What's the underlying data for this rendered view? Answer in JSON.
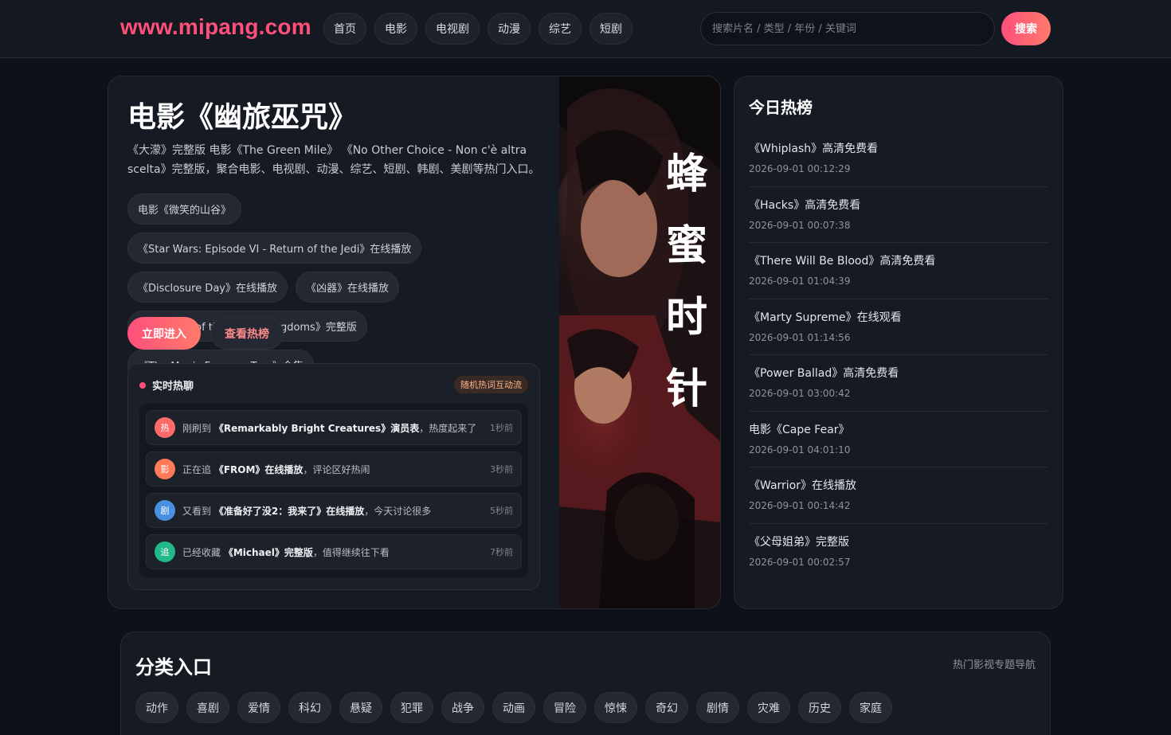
{
  "site": {
    "logo": "www.mipang.com"
  },
  "nav": [
    "首页",
    "电影",
    "电视剧",
    "动漫",
    "综艺",
    "短剧"
  ],
  "search": {
    "placeholder": "搜索片名 / 类型 / 年份 / 关键词",
    "button": "搜索"
  },
  "hero": {
    "title": "电影《幽旅巫咒》",
    "description": "《大濛》完整版 电影《The Green Mile》 《No Other Choice - Non c'è altra scelta》完整版，聚合电影、电视剧、动漫、综艺、短剧、韩剧、美剧等热门入口。",
    "chips": [
      "电影《微笑的山谷》",
      "《Star Wars: Episode VI - Return of the Jedi》在线播放",
      "《Disclosure Day》在线播放",
      "《凶器》在线播放",
      "《A Knight of the Seven Kingdoms》完整版",
      "《The Magic Faraway Tree》全集"
    ],
    "primary_button": "立即进入",
    "secondary_button": "查看热榜"
  },
  "live": {
    "title": "实时热聊",
    "badge": "随机热词互动流",
    "rows": [
      {
        "avatar": "热",
        "color": "#ff6b6b",
        "prefix": "刚刷到",
        "title": "《Remarkably Bright Creatures》演员表",
        "suffix": "，热度起来了",
        "time": "1秒前"
      },
      {
        "avatar": "影",
        "color": "#ff7a59",
        "prefix": "正在追",
        "title": "《FROM》在线播放",
        "suffix": "，评论区好热闹",
        "time": "3秒前"
      },
      {
        "avatar": "剧",
        "color": "#4a90e2",
        "prefix": "又看到",
        "title": "《准备好了没2：我来了》在线播放",
        "suffix": "，今天讨论很多",
        "time": "5秒前"
      },
      {
        "avatar": "追",
        "color": "#22b88a",
        "prefix": "已经收藏",
        "title": "《Michael》完整版",
        "suffix": "，值得继续往下看",
        "time": "7秒前"
      }
    ]
  },
  "poster": {
    "title_text": "蜂蜜时针"
  },
  "hot": {
    "title": "今日热榜",
    "items": [
      {
        "name": "《Whiplash》高清免费看",
        "date": "2026-09-01 00:12:29"
      },
      {
        "name": "《Hacks》高清免费看",
        "date": "2026-09-01 00:07:38"
      },
      {
        "name": "《There Will Be Blood》高清免费看",
        "date": "2026-09-01 01:04:39"
      },
      {
        "name": "《Marty Supreme》在线观看",
        "date": "2026-09-01 01:14:56"
      },
      {
        "name": "《Power Ballad》高清免费看",
        "date": "2026-09-01 03:00:42"
      },
      {
        "name": "电影《Cape Fear》",
        "date": "2026-09-01 04:01:10"
      },
      {
        "name": "《Warrior》在线播放",
        "date": "2026-09-01 00:14:42"
      },
      {
        "name": "《父母姐弟》完整版",
        "date": "2026-09-01 00:02:57"
      }
    ]
  },
  "category": {
    "title": "分类入口",
    "subtitle": "热门影视专题导航",
    "tags": [
      "动作",
      "喜剧",
      "爱情",
      "科幻",
      "悬疑",
      "犯罪",
      "战争",
      "动画",
      "冒险",
      "惊悚",
      "奇幻",
      "剧情",
      "灾难",
      "历史",
      "家庭"
    ]
  }
}
